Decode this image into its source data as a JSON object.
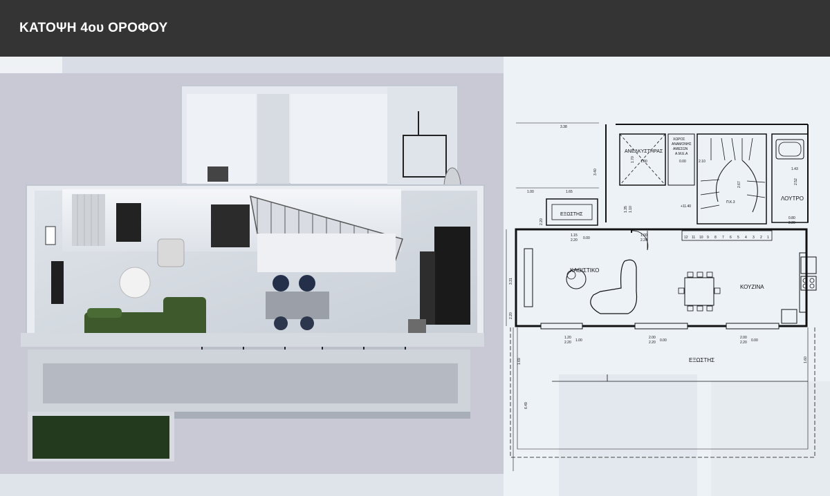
{
  "header": {
    "title": "ΚΑΤΟΨΗ 4ου ΟΡΟΦΟΥ"
  },
  "plan": {
    "rooms": {
      "elevator": "ΑΝΕΛΚΥΣΤΗΡΑΣ",
      "waiting_line1": "ΧΩΡΟΣ",
      "waiting_line2": "ΑΝΑΜΟΝΗΣ",
      "waiting_line3": "ΑΜΕΣΩΝ",
      "waiting_line4": "Α.Μ.Ε.Α",
      "balcony_small": "ΕΞΩΣΤΗΣ",
      "bathroom": "ΛΟΥΤΡΟ",
      "living": "ΚΑΘΙΣΤΙΚΟ",
      "kitchen": "ΚΟΥΖΙΝΑ",
      "balcony_main": "ΕΞΩΣΤΗΣ"
    },
    "dimensions": {
      "top_width": "3.38",
      "elevator_height": "3.40",
      "left_offset": "1.00",
      "balcony_width": "1.65",
      "left_small": "2.20",
      "living_height": "3.31",
      "lower_left": "2.20",
      "balcony_depth": "1.69",
      "balcony_depth_right": "1.60",
      "total_lower": "6.49",
      "bath_width": "1.43",
      "bath_height": "2.52",
      "level": "+11.40",
      "lift_small": "1.70",
      "lift_small2": "1.00",
      "waiting_small": "0.00",
      "stair_small": "2.10",
      "stair_height": "2.67",
      "stair_note": "Π.Κ.3",
      "door_a": "1.00",
      "door_b": "2.20",
      "door_c": "1.15",
      "door_d": "2.20",
      "door_e": "0.00",
      "small_door_a": "0.80",
      "small_door_b": "2.20",
      "left_win_w": "1.35",
      "left_win_h": "1.10",
      "win1_a": "1.20",
      "win1_b": "2.20",
      "win1_c": "1.00",
      "win2_a": "2.00",
      "win2_b": "2.20",
      "win2_c": "0.00",
      "win3_a": "2.00",
      "win3_b": "2.20",
      "win3_c": "0.00",
      "stair_steps": [
        "12",
        "11",
        "10",
        "9",
        "8",
        "7",
        "6",
        "5",
        "4",
        "3",
        "2",
        "1"
      ]
    }
  }
}
